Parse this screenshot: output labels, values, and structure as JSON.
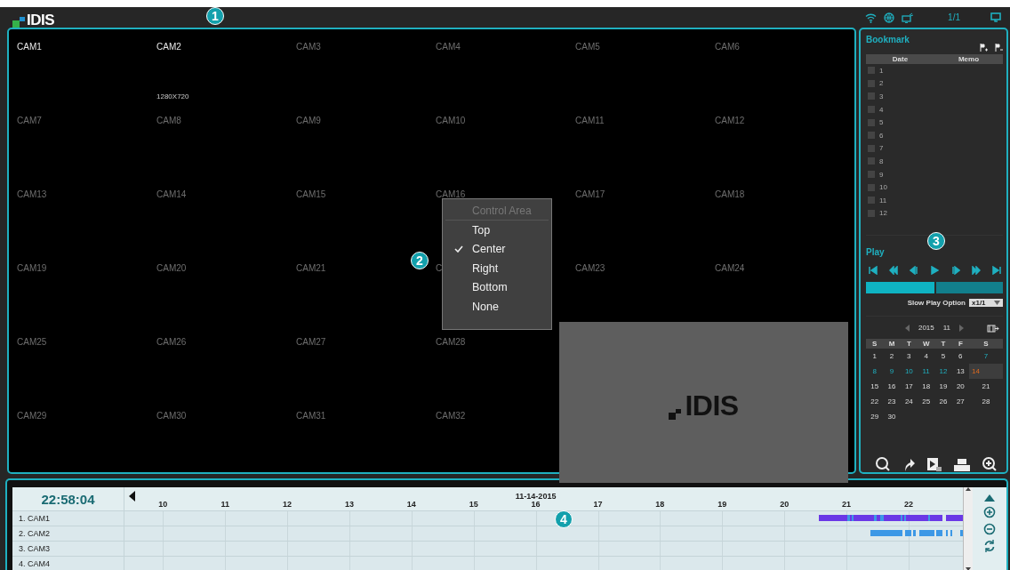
{
  "top_bar": {
    "logo": "IDIS",
    "page": "1/1"
  },
  "callouts": [
    {
      "label": "1"
    },
    {
      "label": "2"
    },
    {
      "label": "3"
    },
    {
      "label": "4"
    }
  ],
  "cameras": [
    {
      "name": "CAM1",
      "active": true
    },
    {
      "name": "CAM2",
      "active": true,
      "resolution": "1280X720"
    },
    {
      "name": "CAM3",
      "active": false
    },
    {
      "name": "CAM4",
      "active": false
    },
    {
      "name": "CAM5",
      "active": false
    },
    {
      "name": "CAM6",
      "active": false
    },
    {
      "name": "CAM7",
      "active": false
    },
    {
      "name": "CAM8",
      "active": false
    },
    {
      "name": "CAM9",
      "active": false
    },
    {
      "name": "CAM10",
      "active": false
    },
    {
      "name": "CAM11",
      "active": false
    },
    {
      "name": "CAM12",
      "active": false
    },
    {
      "name": "CAM13",
      "active": false
    },
    {
      "name": "CAM14",
      "active": false
    },
    {
      "name": "CAM15",
      "active": false
    },
    {
      "name": "CAM16",
      "active": false
    },
    {
      "name": "CAM17",
      "active": false
    },
    {
      "name": "CAM18",
      "active": false
    },
    {
      "name": "CAM19",
      "active": false
    },
    {
      "name": "CAM20",
      "active": false
    },
    {
      "name": "CAM21",
      "active": false
    },
    {
      "name": "C",
      "active": false
    },
    {
      "name": "CAM23",
      "active": false
    },
    {
      "name": "CAM24",
      "active": false
    },
    {
      "name": "CAM25",
      "active": false
    },
    {
      "name": "CAM26",
      "active": false
    },
    {
      "name": "CAM27",
      "active": false
    },
    {
      "name": "CAM28",
      "active": false
    },
    {
      "name": "CAM29",
      "active": false
    },
    {
      "name": "CAM30",
      "active": false
    },
    {
      "name": "CAM31",
      "active": false
    },
    {
      "name": "CAM32",
      "active": false
    }
  ],
  "logo_tile": {
    "text": "IDIS"
  },
  "context_menu": {
    "title": "Control Area",
    "items": [
      {
        "label": "Top",
        "selected": false
      },
      {
        "label": "Center",
        "selected": true
      },
      {
        "label": "Right",
        "selected": false
      },
      {
        "label": "Bottom",
        "selected": false
      },
      {
        "label": "None",
        "selected": false
      }
    ]
  },
  "bookmark": {
    "title": "Bookmark",
    "columns": [
      "Date",
      "Memo"
    ],
    "rows": [
      {
        "label": "1",
        "checked": false
      },
      {
        "label": "2",
        "checked": false
      },
      {
        "label": "3",
        "checked": false
      },
      {
        "label": "4",
        "checked": false
      },
      {
        "label": "5",
        "checked": false
      },
      {
        "label": "6",
        "checked": false
      },
      {
        "label": "7",
        "checked": false
      },
      {
        "label": "8",
        "checked": false
      },
      {
        "label": "9",
        "checked": false
      },
      {
        "label": "10",
        "checked": false
      },
      {
        "label": "11",
        "checked": false
      },
      {
        "label": "12",
        "checked": false
      }
    ]
  },
  "play": {
    "title": "Play",
    "level": 0.5,
    "slow_play_label": "Slow Play Option",
    "slow_play_value": "x1/1"
  },
  "calendar": {
    "year": "2015",
    "month": "11",
    "weekdays": [
      "S",
      "M",
      "T",
      "W",
      "T",
      "F",
      "S"
    ],
    "days": [
      {
        "day": "1",
        "recorded": false,
        "selected": false
      },
      {
        "day": "2",
        "recorded": false,
        "selected": false
      },
      {
        "day": "3",
        "recorded": false,
        "selected": false
      },
      {
        "day": "4",
        "recorded": false,
        "selected": false
      },
      {
        "day": "5",
        "recorded": false,
        "selected": false
      },
      {
        "day": "6",
        "recorded": false,
        "selected": false
      },
      {
        "day": "7",
        "recorded": true,
        "selected": false
      },
      {
        "day": "8",
        "recorded": true,
        "selected": false
      },
      {
        "day": "9",
        "recorded": true,
        "selected": false
      },
      {
        "day": "10",
        "recorded": true,
        "selected": false
      },
      {
        "day": "11",
        "recorded": true,
        "selected": false
      },
      {
        "day": "12",
        "recorded": true,
        "selected": false
      },
      {
        "day": "13",
        "recorded": false,
        "selected": false
      },
      {
        "day": "14",
        "recorded": true,
        "selected": true
      },
      {
        "day": "15",
        "recorded": false,
        "selected": false
      },
      {
        "day": "16",
        "recorded": false,
        "selected": false
      },
      {
        "day": "17",
        "recorded": false,
        "selected": false
      },
      {
        "day": "18",
        "recorded": false,
        "selected": false
      },
      {
        "day": "19",
        "recorded": false,
        "selected": false
      },
      {
        "day": "20",
        "recorded": false,
        "selected": false
      },
      {
        "day": "21",
        "recorded": false,
        "selected": false
      },
      {
        "day": "22",
        "recorded": false,
        "selected": false
      },
      {
        "day": "23",
        "recorded": false,
        "selected": false
      },
      {
        "day": "24",
        "recorded": false,
        "selected": false
      },
      {
        "day": "25",
        "recorded": false,
        "selected": false
      },
      {
        "day": "26",
        "recorded": false,
        "selected": false
      },
      {
        "day": "27",
        "recorded": false,
        "selected": false
      },
      {
        "day": "28",
        "recorded": false,
        "selected": false
      },
      {
        "day": "29",
        "recorded": false,
        "selected": false
      },
      {
        "day": "30",
        "recorded": false,
        "selected": false
      }
    ]
  },
  "timeline": {
    "time": "22:58:04",
    "date": "11-14-2015",
    "hours": [
      "10",
      "11",
      "12",
      "13",
      "14",
      "15",
      "16",
      "17",
      "18",
      "19",
      "20",
      "21",
      "22"
    ],
    "rows": [
      {
        "name": "1. CAM1"
      },
      {
        "name": "2. CAM2"
      },
      {
        "name": "3. CAM3"
      },
      {
        "name": "4. CAM4"
      }
    ]
  }
}
